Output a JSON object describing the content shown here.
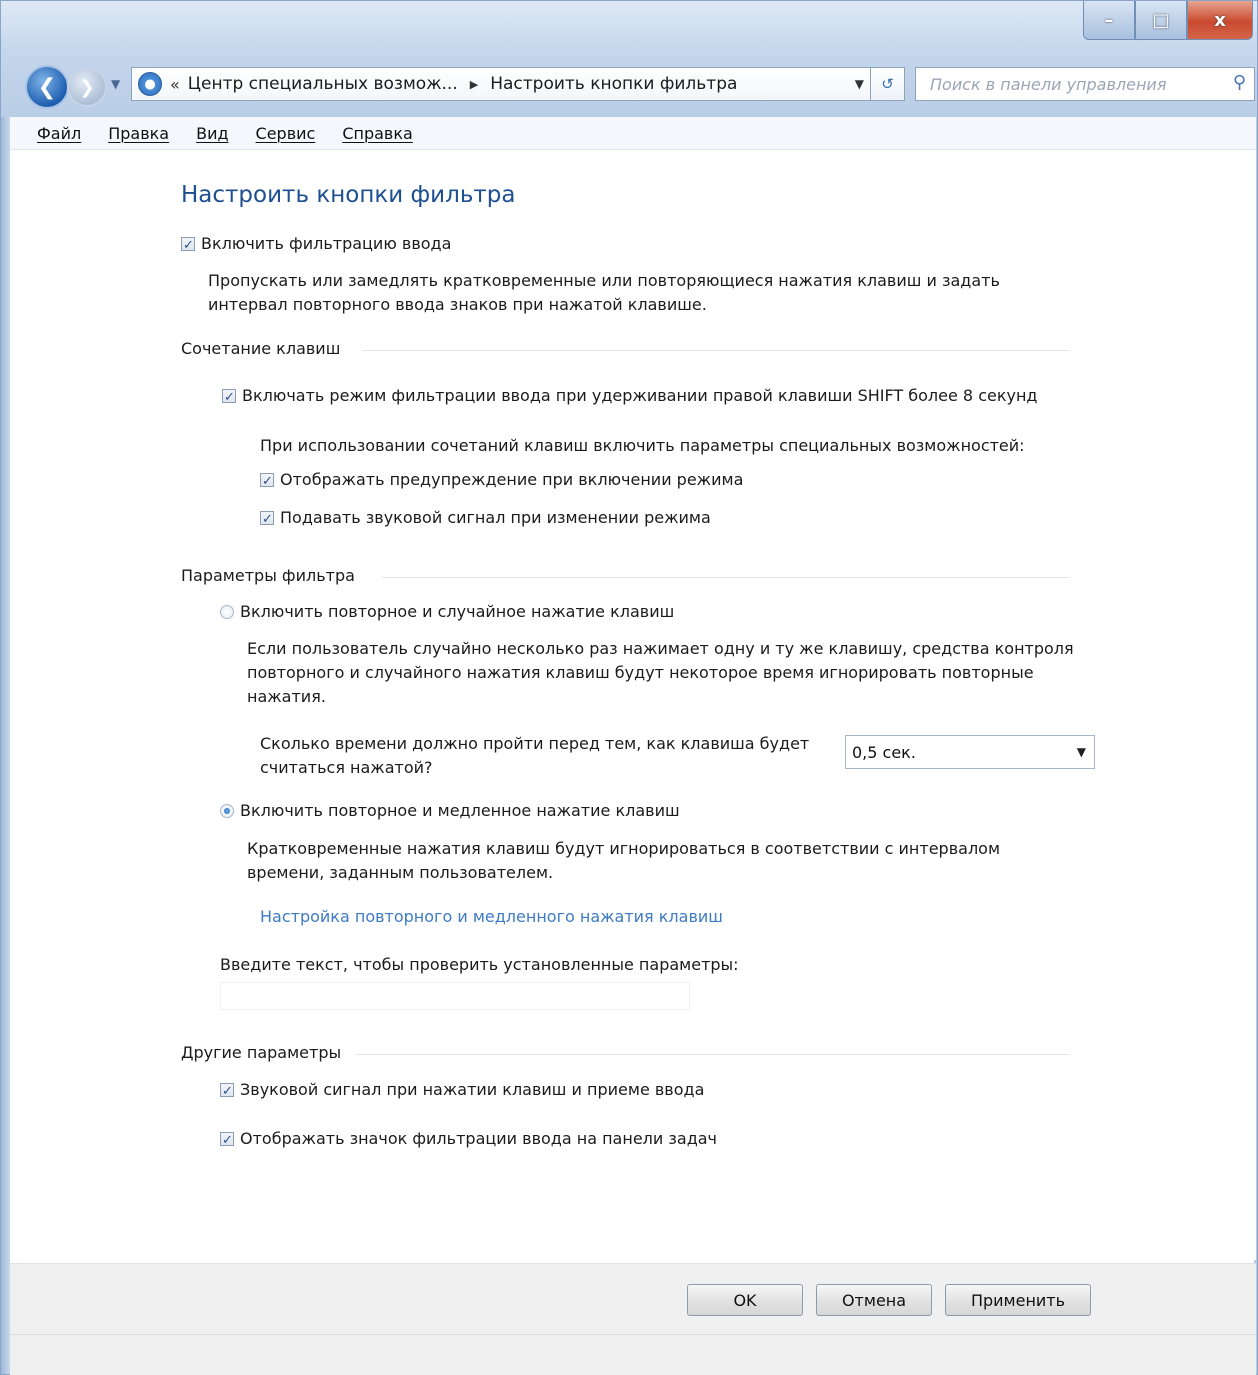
{
  "window": {
    "controls": {
      "minimize": "–",
      "maximize": "□",
      "close": "x"
    }
  },
  "nav": {
    "breadcrumb_prefix": "«",
    "breadcrumb_parent": "Центр специальных возмож...",
    "breadcrumb_sep": "▶",
    "breadcrumb_current": "Настроить кнопки фильтра",
    "search_placeholder": "Поиск в панели управления"
  },
  "menu": {
    "file": "Файл",
    "edit": "Правка",
    "view": "Вид",
    "tools": "Сервис",
    "help": "Справка"
  },
  "page": {
    "title": "Настроить кнопки фильтра",
    "enable_filter": {
      "label": "Включить фильтрацию ввода",
      "checked": true
    },
    "enable_filter_desc_1": "Пропускать или замедлять кратковременные или повторяющиеся нажатия клавиш и задать",
    "enable_filter_desc_2": "интервал повторного ввода знаков при нажатой клавише.",
    "shortcut_group": "Сочетание клавиш",
    "shortcut_shift": {
      "label": "Включать режим фильтрации ввода при удерживании правой клавиши SHIFT более 8 секунд",
      "checked": true
    },
    "shortcut_hint": "При использовании сочетаний клавиш включить параметры специальных возможностей:",
    "shortcut_warning": {
      "label": "Отображать предупреждение при включении режима",
      "checked": true
    },
    "shortcut_sound": {
      "label": "Подавать звуковой сигнал при изменении режима",
      "checked": true
    },
    "filter_group": "Параметры фильтра",
    "radio_bounce": {
      "label": "Включить повторное и случайное нажатие клавиш",
      "selected": false
    },
    "bounce_desc_1": "Если пользователь случайно несколько раз нажимает одну и ту же клавишу, средства контроля",
    "bounce_desc_2": "повторного и случайного нажатия клавиш будут некоторое время игнорировать повторные",
    "bounce_desc_3": "нажатия.",
    "bounce_time_label_1": "Сколько времени должно пройти перед тем, как клавиша будет",
    "bounce_time_label_2": "считаться нажатой?",
    "bounce_time_value": "0,5 сек.",
    "radio_slow": {
      "label": "Включить повторное и медленное нажатие клавиш",
      "selected": true
    },
    "slow_desc_1": "Кратковременные нажатия клавиш будут игнорироваться в соответствии с интервалом",
    "slow_desc_2": "времени, заданным пользователем.",
    "slow_link": "Настройка повторного и медленного нажатия клавиш",
    "test_label": "Введите текст, чтобы проверить установленные параметры:",
    "other_group": "Другие параметры",
    "other_beep": {
      "label": "Звуковой сигнал при нажатии клавиш и приеме ввода",
      "checked": true
    },
    "other_icon": {
      "label": "Отображать значок фильтрации ввода на панели задач",
      "checked": true
    }
  },
  "buttons": {
    "ok": "OK",
    "cancel": "Отмена",
    "apply": "Применить"
  }
}
